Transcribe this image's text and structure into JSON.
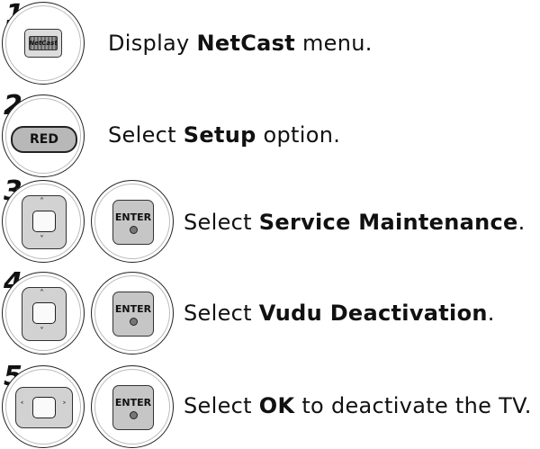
{
  "steps": [
    {
      "number": "1",
      "pre": "Display ",
      "bold": "NetCast",
      "post": " menu.",
      "keys": [
        "netcast-button"
      ]
    },
    {
      "number": "2",
      "pre": "Select ",
      "bold": "Setup",
      "post": " option.",
      "keys": [
        "red-button"
      ]
    },
    {
      "number": "3",
      "pre": "Select ",
      "bold": "Service Maintenance",
      "post": ".",
      "keys": [
        "dpad-up-down",
        "enter-button"
      ]
    },
    {
      "number": "4",
      "pre": "Select ",
      "bold": "Vudu Deactivation",
      "post": ".",
      "keys": [
        "dpad-up-down",
        "enter-button"
      ]
    },
    {
      "number": "5",
      "pre": "Select ",
      "bold": "OK",
      "post": " to deactivate the TV.",
      "keys": [
        "dpad-left-right",
        "enter-button"
      ]
    }
  ],
  "keys": {
    "netcast_logo": "NetCast",
    "red": "RED",
    "enter": "ENTER"
  }
}
